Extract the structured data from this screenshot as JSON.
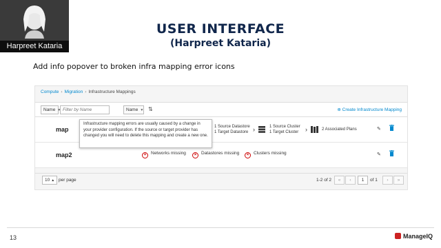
{
  "presenter": {
    "name": "Harpreet Kataria"
  },
  "slide": {
    "title": "USER INTERFACE",
    "subtitle": "(Harpreet Kataria)",
    "description": "Add info popover to broken infra mapping error icons",
    "page_number": "13",
    "brand": "ManageIQ"
  },
  "breadcrumb": [
    "Compute",
    "Migration",
    "Infrastructure Mappings"
  ],
  "toolbar": {
    "filter_field": "Name",
    "filter_placeholder": "Filter by Name",
    "sort_field": "Name",
    "create_label": "Create Infrastructure Mapping"
  },
  "rows": [
    {
      "name": "map",
      "datastores": [
        "1 Source Datastore",
        "1 Target Datastore"
      ],
      "clusters": [
        "1 Source Cluster",
        "1 Target Cluster"
      ],
      "plans": "2 Associated Plans"
    },
    {
      "name": "map2",
      "errors": [
        "Networks missing",
        "Datastores missing",
        "Clusters missing"
      ]
    }
  ],
  "popover": {
    "text": "Infrastructure mapping errors are usually caused by a change in your provider configuration. If the source or target provider has changed you will need to delete this mapping and create a new one."
  },
  "pagination": {
    "per_page": "10",
    "per_page_label": "per page",
    "range": "1-2 of 2",
    "current_page": "1",
    "of_total": "of 1"
  },
  "colors": {
    "title": "#10264b",
    "link": "#0088ce",
    "error": "#cc0000"
  },
  "icons": [
    "chevron-down-icon",
    "sort-icon",
    "plus-circle-icon",
    "datastore-icon",
    "cluster-icon",
    "plans-icon",
    "error-icon",
    "pencil-icon",
    "trash-icon"
  ]
}
